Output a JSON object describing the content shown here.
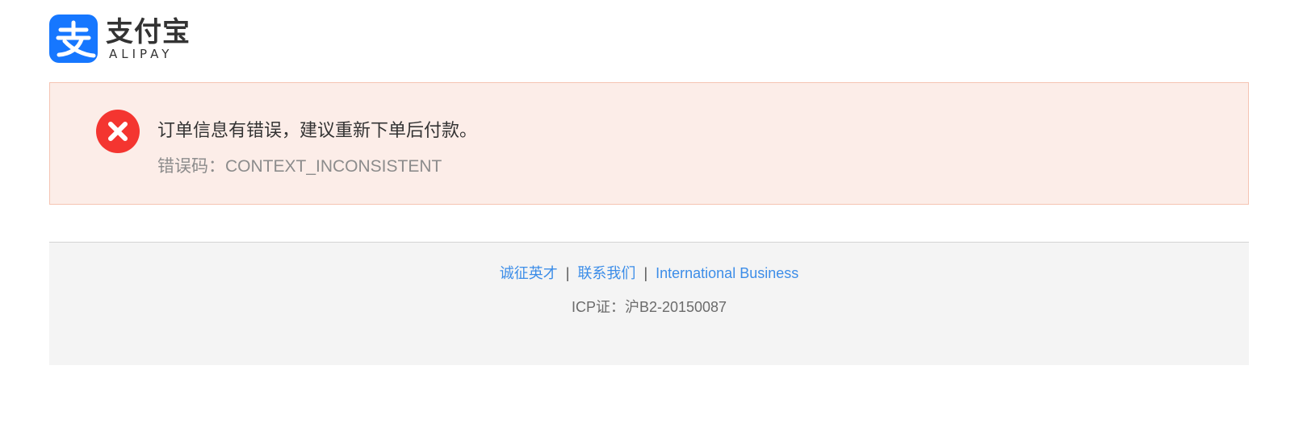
{
  "brand": {
    "name_cn": "支付宝",
    "name_en": "ALIPAY",
    "logo_icon": "alipay-zhi-icon",
    "color": "#1677ff"
  },
  "error": {
    "icon": "error-x-circle-icon",
    "icon_color": "#f43530",
    "message": "订单信息有错误，建议重新下单后付款。",
    "code_label": "错误码：",
    "code_value": "CONTEXT_INCONSISTENT"
  },
  "footer": {
    "links": [
      {
        "label": "诚征英才"
      },
      {
        "label": "联系我们"
      },
      {
        "label": "International Business"
      }
    ],
    "separator": "|",
    "icp": "ICP证：沪B2-20150087"
  }
}
